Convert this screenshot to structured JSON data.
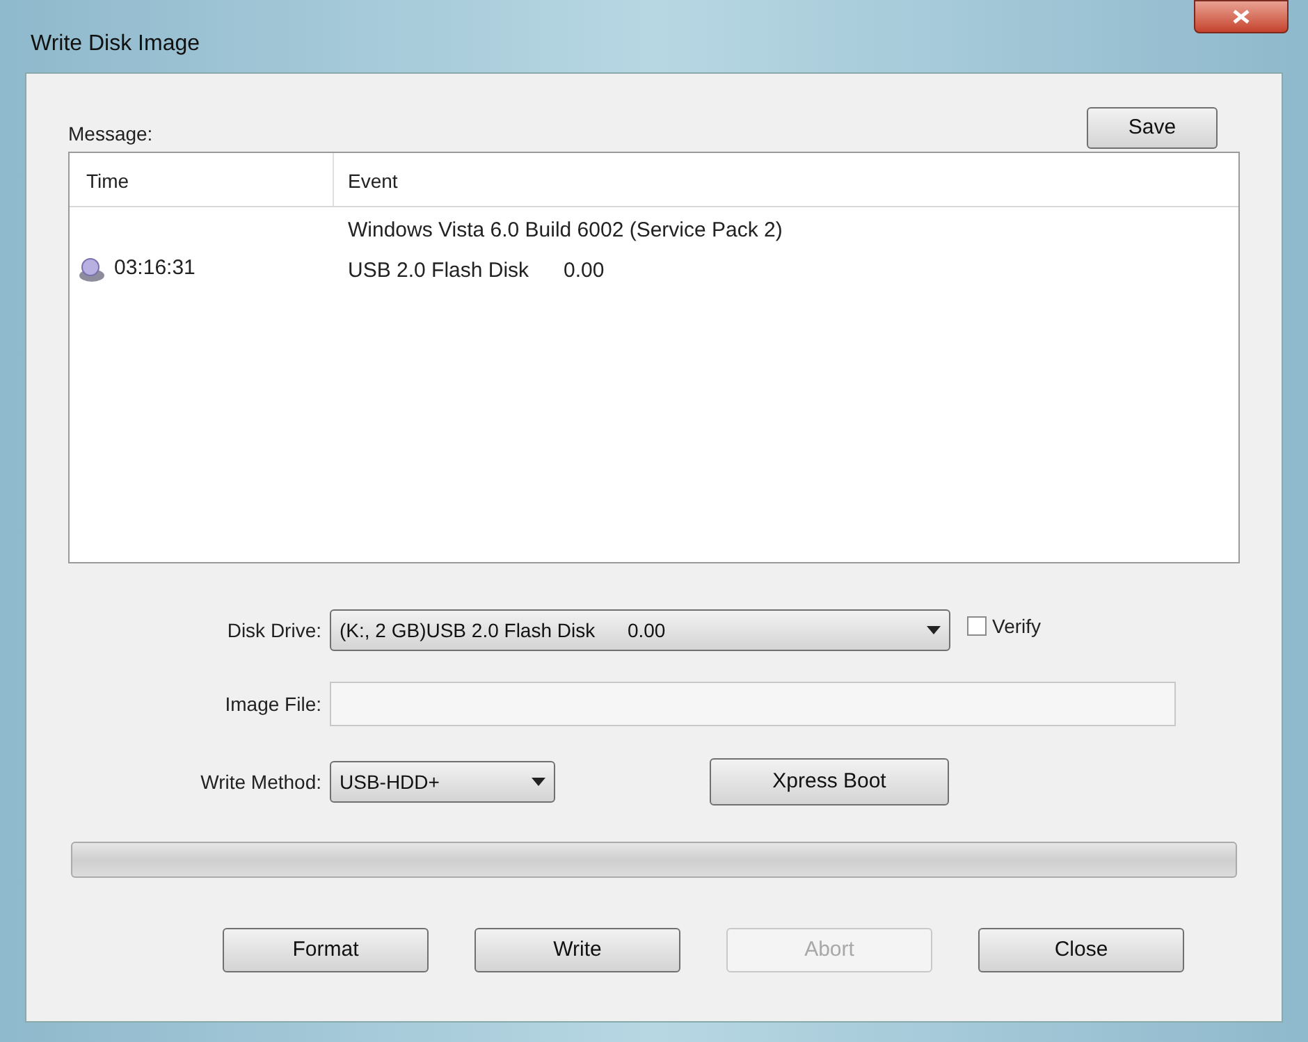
{
  "window": {
    "title": "Write Disk Image"
  },
  "message": {
    "label": "Message:",
    "save_button": "Save",
    "columns": [
      "Time",
      "Event"
    ],
    "rows": [
      {
        "time": "03:16:31",
        "events": [
          "Windows Vista 6.0 Build 6002 (Service Pack 2)",
          "USB 2.0 Flash Disk      0.00"
        ]
      }
    ]
  },
  "disk_drive": {
    "label": "Disk Drive:",
    "value": "(K:, 2 GB)USB 2.0 Flash Disk      0.00"
  },
  "verify": {
    "label": "Verify",
    "checked": false
  },
  "image_file": {
    "label": "Image File:"
  },
  "write_method": {
    "label": "Write Method:",
    "value": "USB-HDD+"
  },
  "xpress_boot_button": "Xpress Boot",
  "progress": {
    "level": 0
  },
  "buttons": [
    {
      "label": "Format",
      "disabled": false
    },
    {
      "label": "Write",
      "disabled": false
    },
    {
      "label": "Abort",
      "disabled": true
    },
    {
      "label": "Close",
      "disabled": false
    }
  ]
}
